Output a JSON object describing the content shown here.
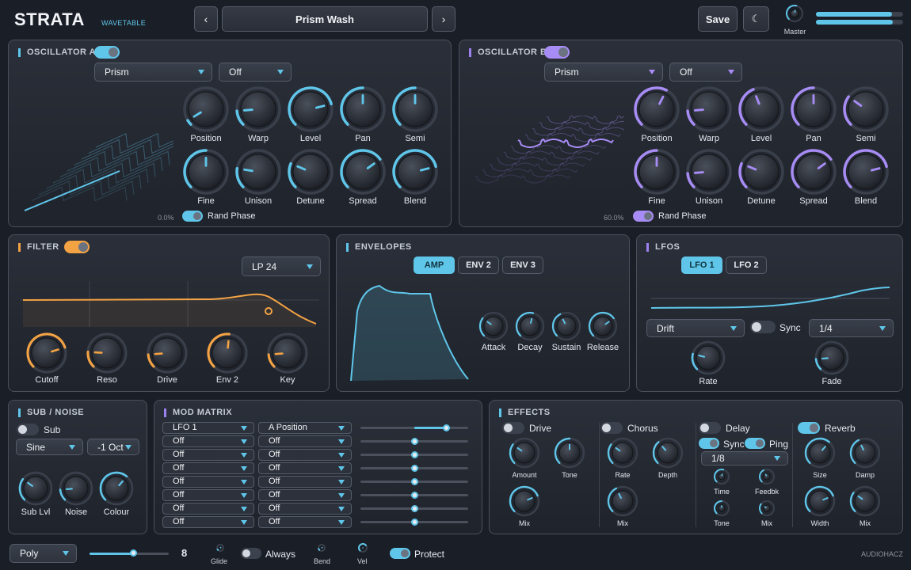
{
  "app": {
    "title": "STRATA",
    "subtitle": "WAVETABLE",
    "preset": "Prism Wash",
    "save": "Save",
    "theme_icon": "☾",
    "master_label": "Master",
    "brand": "AUDIOHACZ",
    "meter": [
      0.87,
      0.88
    ]
  },
  "colors": {
    "accent": "#5fc6ea",
    "osc_b": "#a88cf5",
    "filter": "#f3a244"
  },
  "osc_a": {
    "title": "OSCILLATOR A",
    "enabled": true,
    "wavetable": "Prism",
    "mode": "Off",
    "value_readout": "0.0%",
    "rand_phase_label": "Rand Phase",
    "rand_phase_on": true,
    "knobs": [
      {
        "label": "Position",
        "value": 0.05
      },
      {
        "label": "Warp",
        "value": 0.15
      },
      {
        "label": "Level",
        "value": 0.78
      },
      {
        "label": "Pan",
        "value": 0.5
      },
      {
        "label": "Semi",
        "value": 0.5
      },
      {
        "label": "Fine",
        "value": 0.5
      },
      {
        "label": "Unison",
        "value": 0.2
      },
      {
        "label": "Detune",
        "value": 0.25
      },
      {
        "label": "Spread",
        "value": 0.7
      },
      {
        "label": "Blend",
        "value": 0.78
      }
    ]
  },
  "osc_b": {
    "title": "OSCILLATOR B",
    "enabled": true,
    "wavetable": "Prism",
    "mode": "Off",
    "value_readout": "60.0%",
    "rand_phase_label": "Rand Phase",
    "rand_phase_on": true,
    "knobs": [
      {
        "label": "Position",
        "value": 0.6
      },
      {
        "label": "Warp",
        "value": 0.15
      },
      {
        "label": "Level",
        "value": 0.42
      },
      {
        "label": "Pan",
        "value": 0.5
      },
      {
        "label": "Semi",
        "value": 0.3
      },
      {
        "label": "Fine",
        "value": 0.5
      },
      {
        "label": "Unison",
        "value": 0.15
      },
      {
        "label": "Detune",
        "value": 0.25
      },
      {
        "label": "Spread",
        "value": 0.7
      },
      {
        "label": "Blend",
        "value": 0.78
      }
    ]
  },
  "filter": {
    "title": "FILTER",
    "enabled": true,
    "type": "LP 24",
    "knobs": [
      {
        "label": "Cutoff",
        "value": 0.77
      },
      {
        "label": "Reso",
        "value": 0.18
      },
      {
        "label": "Drive",
        "value": 0.15
      },
      {
        "label": "Env 2",
        "value": 0.52
      },
      {
        "label": "Key",
        "value": 0.15
      }
    ]
  },
  "envelopes": {
    "title": "ENVELOPES",
    "tabs": [
      "AMP",
      "ENV 2",
      "ENV 3"
    ],
    "active": 0,
    "knobs": [
      {
        "label": "Attack",
        "value": 0.3
      },
      {
        "label": "Decay",
        "value": 0.55
      },
      {
        "label": "Sustain",
        "value": 0.4
      },
      {
        "label": "Release",
        "value": 0.7
      }
    ]
  },
  "lfos": {
    "title": "LFOS",
    "tabs": [
      "LFO 1",
      "LFO 2"
    ],
    "active": 0,
    "shape": "Drift",
    "sync_label": "Sync",
    "sync_on": false,
    "rate_div": "1/4",
    "knobs": [
      {
        "label": "Rate",
        "value": 0.22
      },
      {
        "label": "Fade",
        "value": 0.15
      }
    ]
  },
  "sub": {
    "title": "SUB / NOISE",
    "sub_label": "Sub",
    "sub_on": false,
    "wave": "Sine",
    "octave": "-1 Oct",
    "knobs": [
      {
        "label": "Sub Lvl",
        "value": 0.3
      },
      {
        "label": "Noise",
        "value": 0.15
      },
      {
        "label": "Colour",
        "value": 0.65
      }
    ]
  },
  "mod": {
    "title": "MOD MATRIX",
    "rows": [
      {
        "source": "LFO 1",
        "dest": "A Position",
        "amount": 0.8
      },
      {
        "source": "Off",
        "dest": "Off",
        "amount": 0.5
      },
      {
        "source": "Off",
        "dest": "Off",
        "amount": 0.5
      },
      {
        "source": "Off",
        "dest": "Off",
        "amount": 0.5
      },
      {
        "source": "Off",
        "dest": "Off",
        "amount": 0.5
      },
      {
        "source": "Off",
        "dest": "Off",
        "amount": 0.5
      },
      {
        "source": "Off",
        "dest": "Off",
        "amount": 0.5
      },
      {
        "source": "Off",
        "dest": "Off",
        "amount": 0.5
      }
    ]
  },
  "effects": {
    "title": "EFFECTS",
    "drive": {
      "label": "Drive",
      "on": false,
      "knobs": [
        {
          "label": "Amount",
          "value": 0.3
        },
        {
          "label": "Tone",
          "value": 0.5
        },
        {
          "label": "Mix",
          "value": 0.75
        }
      ]
    },
    "chorus": {
      "label": "Chorus",
      "on": false,
      "knobs": [
        {
          "label": "Rate",
          "value": 0.3
        },
        {
          "label": "Depth",
          "value": 0.35
        },
        {
          "label": "Mix",
          "value": 0.4
        }
      ]
    },
    "delay": {
      "label": "Delay",
      "on": false,
      "sync_label": "Sync",
      "sync_on": true,
      "ping_label": "Ping",
      "ping_on": true,
      "div": "1/8",
      "knobs": [
        {
          "label": "Time",
          "value": 0.55
        },
        {
          "label": "Feedbk",
          "value": 0.4
        },
        {
          "label": "Tone",
          "value": 0.5
        },
        {
          "label": "Mix",
          "value": 0.3
        }
      ]
    },
    "reverb": {
      "label": "Reverb",
      "on": true,
      "knobs": [
        {
          "label": "Size",
          "value": 0.65
        },
        {
          "label": "Damp",
          "value": 0.4
        },
        {
          "label": "Width",
          "value": 0.75
        },
        {
          "label": "Mix",
          "value": 0.3
        }
      ]
    }
  },
  "footer": {
    "voice_mode": "Poly",
    "voices": "8",
    "voices_value": 0.55,
    "glide": "Glide",
    "always": "Always",
    "always_on": false,
    "bend": "Bend",
    "vel": "Vel",
    "protect": "Protect",
    "protect_on": true
  }
}
